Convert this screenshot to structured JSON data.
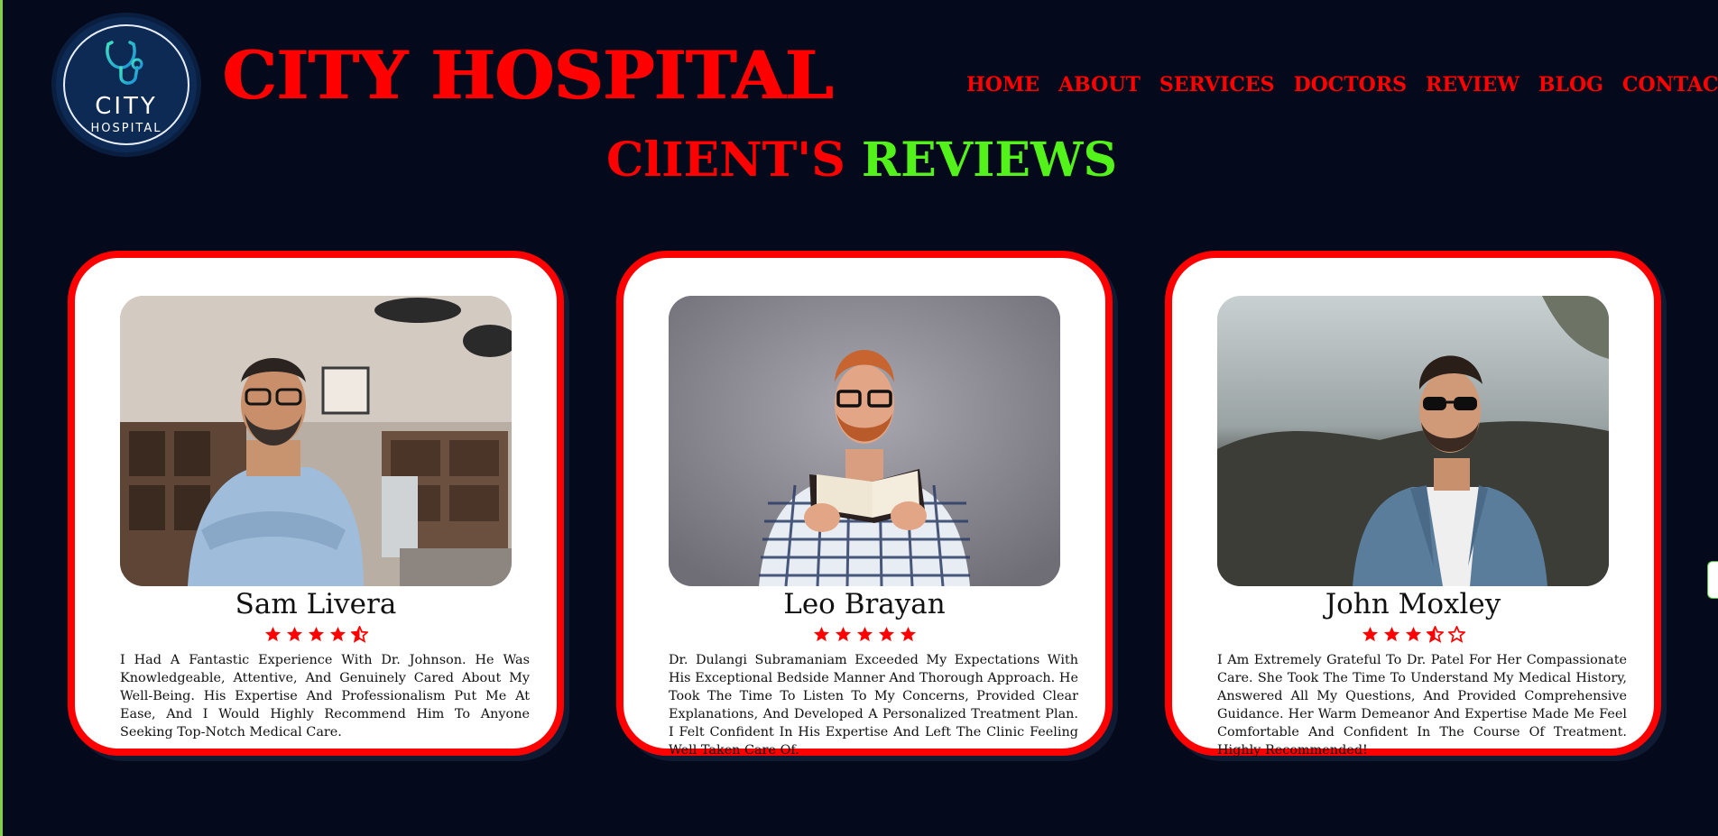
{
  "brand": {
    "logo_line1": "CITY",
    "logo_line2": "HOSPITAL",
    "name": "CITY HOSPITAL"
  },
  "nav": [
    "HOME",
    "ABOUT",
    "SERVICES",
    "DOCTORS",
    "REVIEW",
    "BLOG",
    "CONTACT"
  ],
  "section": {
    "title_part1": "ClIENT'S",
    "title_part2": "REVIEWS"
  },
  "colors": {
    "accent_red": "#ff0000",
    "accent_green": "#52f21a",
    "background": "#05091c"
  },
  "reviews": [
    {
      "name": "Sam Livera",
      "rating": 4.5,
      "photo": "man-in-office-photo",
      "text": "I Had A Fantastic Experience With Dr. Johnson. He Was Knowledgeable, Attentive, And Genuinely Cared About My Well-Being. His Expertise And Professionalism Put Me At Ease, And I Would Highly Recommend Him To Anyone Seeking Top-Notch Medical Care."
    },
    {
      "name": "Leo Brayan",
      "rating": 5,
      "photo": "man-with-book-photo",
      "text": "Dr. Dulangi Subramaniam Exceeded My Expectations With His Exceptional Bedside Manner And Thorough Approach. He Took The Time To Listen To My Concerns, Provided Clear Explanations, And Developed A Personalized Treatment Plan. I Felt Confident In His Expertise And Left The Clinic Feeling Well Taken Care Of."
    },
    {
      "name": "John Moxley",
      "rating": 3.5,
      "photo": "man-in-denim-jacket-photo",
      "text": "I Am Extremely Grateful To Dr. Patel For Her Compassionate Care. She Took The Time To Understand My Medical History, Answered All My Questions, And Provided Comprehensive Guidance. Her Warm Demeanor And Expertise Made Me Feel Comfortable And Confident In The Course Of Treatment. Highly Recommended!"
    }
  ]
}
